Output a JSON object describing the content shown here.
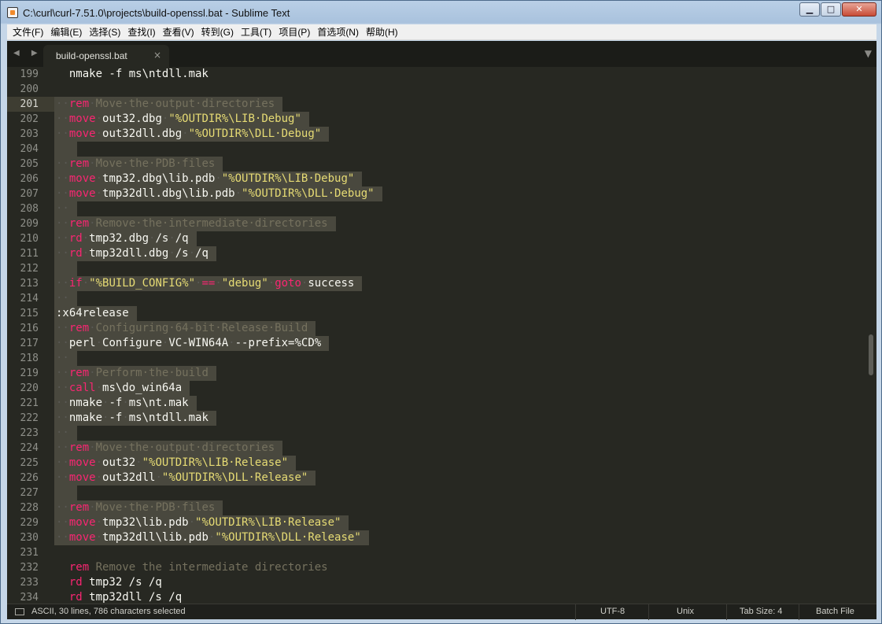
{
  "window": {
    "title": "C:\\curl\\curl-7.51.0\\projects\\build-openssl.bat - Sublime Text",
    "minimize": "▁",
    "maximize": "□",
    "close": "✕"
  },
  "menu": [
    "文件(F)",
    "编辑(E)",
    "选择(S)",
    "查找(I)",
    "查看(V)",
    "转到(G)",
    "工具(T)",
    "项目(P)",
    "首选项(N)",
    "帮助(H)"
  ],
  "tabbar": {
    "nav": "◀ ▶",
    "tab_label": "build-openssl.bat",
    "tab_close": "×",
    "dropdown": "▼"
  },
  "editor": {
    "line_numbers": [
      "199",
      "200",
      "201",
      "202",
      "203",
      "204",
      "205",
      "206",
      "207",
      "208",
      "209",
      "210",
      "211",
      "212",
      "213",
      "214",
      "215",
      "216",
      "217",
      "218",
      "219",
      "220",
      "221",
      "222",
      "223",
      "224",
      "225",
      "226",
      "227",
      "228",
      "229",
      "230",
      "231",
      "232",
      "233",
      "234"
    ],
    "active_line_index": 2,
    "lines": [
      {
        "sel": false,
        "parts": [
          [
            "ws",
            "  "
          ],
          [
            "txt",
            "nmake -f ms\\ntdll.mak"
          ]
        ]
      },
      {
        "sel": false,
        "parts": []
      },
      {
        "sel": true,
        "parts": [
          [
            "ws",
            "··"
          ],
          [
            "kw",
            "rem"
          ],
          [
            "ws",
            "·"
          ],
          [
            "cm",
            "Move·the·output·directories"
          ]
        ]
      },
      {
        "sel": true,
        "parts": [
          [
            "ws",
            "··"
          ],
          [
            "kw",
            "move"
          ],
          [
            "ws",
            "·"
          ],
          [
            "txt",
            "out32.dbg"
          ],
          [
            "ws",
            "·"
          ],
          [
            "str",
            "\"%OUTDIR%\\LIB·Debug\""
          ]
        ]
      },
      {
        "sel": true,
        "parts": [
          [
            "ws",
            "··"
          ],
          [
            "kw",
            "move"
          ],
          [
            "ws",
            "·"
          ],
          [
            "txt",
            "out32dll.dbg"
          ],
          [
            "ws",
            "·"
          ],
          [
            "str",
            "\"%OUTDIR%\\DLL·Debug\""
          ]
        ]
      },
      {
        "sel": true,
        "parts": []
      },
      {
        "sel": true,
        "parts": [
          [
            "ws",
            "··"
          ],
          [
            "kw",
            "rem"
          ],
          [
            "ws",
            "·"
          ],
          [
            "cm",
            "Move·the·PDB·files"
          ]
        ]
      },
      {
        "sel": true,
        "parts": [
          [
            "ws",
            "··"
          ],
          [
            "kw",
            "move"
          ],
          [
            "ws",
            "·"
          ],
          [
            "txt",
            "tmp32.dbg\\lib.pdb"
          ],
          [
            "ws",
            "·"
          ],
          [
            "str",
            "\"%OUTDIR%\\LIB·Debug\""
          ]
        ]
      },
      {
        "sel": true,
        "parts": [
          [
            "ws",
            "··"
          ],
          [
            "kw",
            "move"
          ],
          [
            "ws",
            "·"
          ],
          [
            "txt",
            "tmp32dll.dbg\\lib.pdb"
          ],
          [
            "ws",
            "·"
          ],
          [
            "str",
            "\"%OUTDIR%\\DLL·Debug\""
          ]
        ]
      },
      {
        "sel": true,
        "parts": [
          [
            "ws",
            "··"
          ]
        ]
      },
      {
        "sel": true,
        "parts": [
          [
            "ws",
            "··"
          ],
          [
            "kw",
            "rem"
          ],
          [
            "ws",
            "·"
          ],
          [
            "cm",
            "Remove·the·intermediate·directories"
          ]
        ]
      },
      {
        "sel": true,
        "parts": [
          [
            "ws",
            "··"
          ],
          [
            "kw",
            "rd"
          ],
          [
            "ws",
            "·"
          ],
          [
            "txt",
            "tmp32.dbg"
          ],
          [
            "ws",
            "·"
          ],
          [
            "txt",
            "/s"
          ],
          [
            "ws",
            "·"
          ],
          [
            "txt",
            "/q"
          ]
        ]
      },
      {
        "sel": true,
        "parts": [
          [
            "ws",
            "··"
          ],
          [
            "kw",
            "rd"
          ],
          [
            "ws",
            "·"
          ],
          [
            "txt",
            "tmp32dll.dbg"
          ],
          [
            "ws",
            "·"
          ],
          [
            "txt",
            "/s"
          ],
          [
            "ws",
            "·"
          ],
          [
            "txt",
            "/q"
          ]
        ]
      },
      {
        "sel": true,
        "parts": []
      },
      {
        "sel": true,
        "parts": [
          [
            "ws",
            "··"
          ],
          [
            "kw",
            "if"
          ],
          [
            "ws",
            "·"
          ],
          [
            "str",
            "\"%BUILD_CONFIG%\""
          ],
          [
            "ws",
            "·"
          ],
          [
            "kw",
            "=="
          ],
          [
            "ws",
            "·"
          ],
          [
            "str",
            "\"debug\""
          ],
          [
            "ws",
            "·"
          ],
          [
            "kw",
            "goto"
          ],
          [
            "ws",
            "·"
          ],
          [
            "txt",
            "success"
          ]
        ]
      },
      {
        "sel": true,
        "parts": [
          [
            "ws",
            "··"
          ]
        ]
      },
      {
        "sel": true,
        "parts": [
          [
            "txt",
            ":x64release"
          ]
        ]
      },
      {
        "sel": true,
        "parts": [
          [
            "ws",
            "··"
          ],
          [
            "kw",
            "rem"
          ],
          [
            "ws",
            "·"
          ],
          [
            "cm",
            "Configuring·64-bit·Release·Build"
          ]
        ]
      },
      {
        "sel": true,
        "parts": [
          [
            "ws",
            "··"
          ],
          [
            "txt",
            "perl"
          ],
          [
            "ws",
            "·"
          ],
          [
            "txt",
            "Configure"
          ],
          [
            "ws",
            "·"
          ],
          [
            "txt",
            "VC-WIN64A"
          ],
          [
            "ws",
            "·"
          ],
          [
            "txt",
            "--prefix=%CD%"
          ]
        ]
      },
      {
        "sel": true,
        "parts": [
          [
            "ws",
            "··"
          ]
        ]
      },
      {
        "sel": true,
        "parts": [
          [
            "ws",
            "··"
          ],
          [
            "kw",
            "rem"
          ],
          [
            "ws",
            "·"
          ],
          [
            "cm",
            "Perform·the·build"
          ]
        ]
      },
      {
        "sel": true,
        "parts": [
          [
            "ws",
            "··"
          ],
          [
            "kw",
            "call"
          ],
          [
            "ws",
            "·"
          ],
          [
            "txt",
            "ms\\do_win64a"
          ]
        ]
      },
      {
        "sel": true,
        "parts": [
          [
            "ws",
            "··"
          ],
          [
            "txt",
            "nmake"
          ],
          [
            "ws",
            "·"
          ],
          [
            "txt",
            "-f"
          ],
          [
            "ws",
            "·"
          ],
          [
            "txt",
            "ms\\nt.mak"
          ]
        ]
      },
      {
        "sel": true,
        "parts": [
          [
            "ws",
            "··"
          ],
          [
            "txt",
            "nmake"
          ],
          [
            "ws",
            "·"
          ],
          [
            "txt",
            "-f"
          ],
          [
            "ws",
            "·"
          ],
          [
            "txt",
            "ms\\ntdll.mak"
          ]
        ]
      },
      {
        "sel": true,
        "parts": [
          [
            "ws",
            "··"
          ]
        ]
      },
      {
        "sel": true,
        "parts": [
          [
            "ws",
            "··"
          ],
          [
            "kw",
            "rem"
          ],
          [
            "ws",
            "·"
          ],
          [
            "cm",
            "Move·the·output·directories"
          ]
        ]
      },
      {
        "sel": true,
        "parts": [
          [
            "ws",
            "··"
          ],
          [
            "kw",
            "move"
          ],
          [
            "ws",
            "·"
          ],
          [
            "txt",
            "out32"
          ],
          [
            "ws",
            "·"
          ],
          [
            "str",
            "\"%OUTDIR%\\LIB·Release\""
          ]
        ]
      },
      {
        "sel": true,
        "parts": [
          [
            "ws",
            "··"
          ],
          [
            "kw",
            "move"
          ],
          [
            "ws",
            "·"
          ],
          [
            "txt",
            "out32dll"
          ],
          [
            "ws",
            "·"
          ],
          [
            "str",
            "\"%OUTDIR%\\DLL·Release\""
          ]
        ]
      },
      {
        "sel": true,
        "parts": []
      },
      {
        "sel": true,
        "parts": [
          [
            "ws",
            "··"
          ],
          [
            "kw",
            "rem"
          ],
          [
            "ws",
            "·"
          ],
          [
            "cm",
            "Move·the·PDB·files"
          ]
        ]
      },
      {
        "sel": true,
        "parts": [
          [
            "ws",
            "··"
          ],
          [
            "kw",
            "move"
          ],
          [
            "ws",
            "·"
          ],
          [
            "txt",
            "tmp32\\lib.pdb"
          ],
          [
            "ws",
            "·"
          ],
          [
            "str",
            "\"%OUTDIR%\\LIB·Release\""
          ]
        ]
      },
      {
        "sel": true,
        "parts": [
          [
            "ws",
            "··"
          ],
          [
            "kw",
            "move"
          ],
          [
            "ws",
            "·"
          ],
          [
            "txt",
            "tmp32dll\\lib.pdb"
          ],
          [
            "ws",
            "·"
          ],
          [
            "str",
            "\"%OUTDIR%\\DLL·Release\""
          ]
        ]
      },
      {
        "sel": false,
        "parts": []
      },
      {
        "sel": false,
        "parts": [
          [
            "ws",
            "  "
          ],
          [
            "kw",
            "rem"
          ],
          [
            "cm",
            " Remove the intermediate directories"
          ]
        ]
      },
      {
        "sel": false,
        "parts": [
          [
            "ws",
            "  "
          ],
          [
            "kw",
            "rd"
          ],
          [
            "txt",
            " tmp32 /s /q"
          ]
        ]
      },
      {
        "sel": false,
        "parts": [
          [
            "ws",
            "  "
          ],
          [
            "kw",
            "rd"
          ],
          [
            "txt",
            " tmp32dll /s /q"
          ]
        ]
      }
    ]
  },
  "status": {
    "selection": "ASCII, 30 lines, 786 characters selected",
    "encoding": "UTF-8",
    "line_endings": "Unix",
    "tab_size": "Tab Size: 4",
    "syntax": "Batch File"
  },
  "colors": {
    "background": "#272822",
    "selection": "#49483e",
    "keyword": "#f92672",
    "string": "#e6db74",
    "comment": "#75715e",
    "text": "#f8f8f2"
  }
}
